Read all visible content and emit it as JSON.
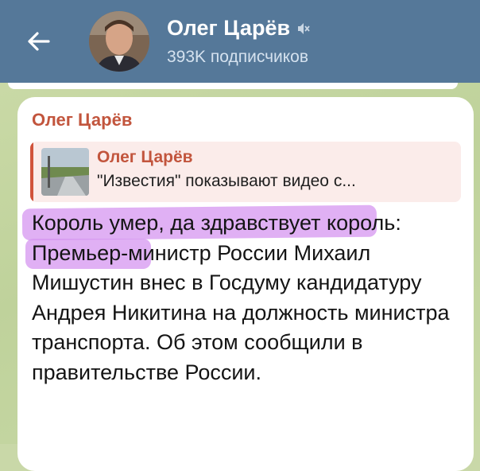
{
  "header": {
    "title": "Олег Царёв",
    "subtitle": "393K подписчиков",
    "back_icon": "arrow-left-icon",
    "mute_icon": "speaker-muted-icon",
    "background_color": "#557899"
  },
  "message": {
    "sender": "Олег Царёв",
    "sender_color": "#c2553d",
    "reply": {
      "author": "Олег Царёв",
      "text": "\"Известия\" показывают видео с...",
      "accent_color": "#d0533b"
    },
    "text": "Король умер, да здравствует король: Премьер-министр России Михаил Мишустин внес в Госдуму кандидатуру Андрея Никитина на должность министра транспорта. Об этом сообщили в правительстве России.",
    "highlight_color": "#d696f0"
  }
}
